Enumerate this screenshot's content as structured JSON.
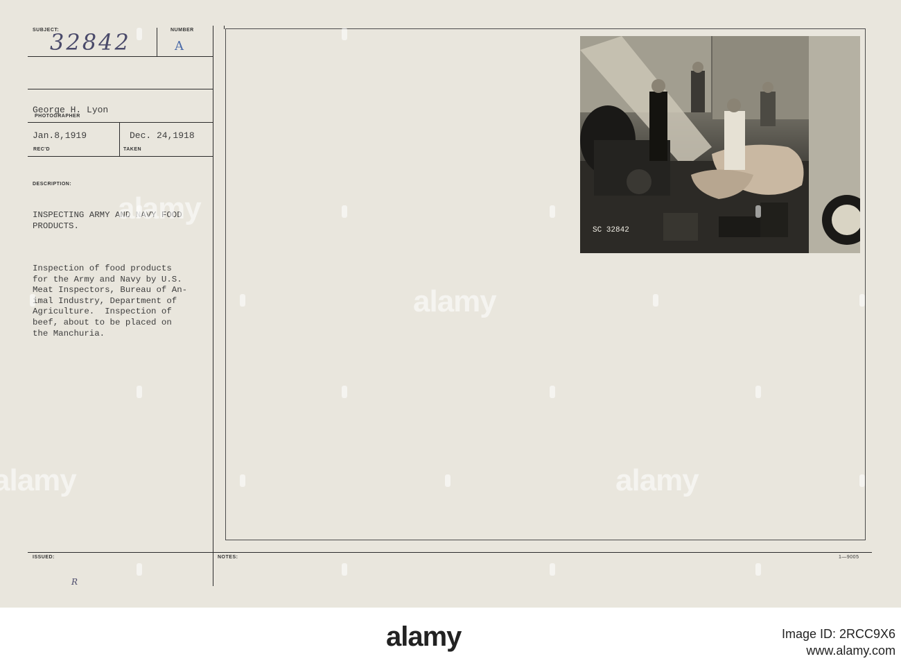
{
  "card": {
    "subject_label": "SUBJECT:",
    "subject_number": "32842",
    "number_label": "NUMBER",
    "number_value": "A",
    "photographer_name": "George H. Lyon",
    "photographer_label": "PHOTOGRAPHER",
    "received_date": "Jan.8,1919",
    "received_label": "REC'D",
    "taken_date": "Dec. 24,1918",
    "taken_label": "TAKEN",
    "description_label": "DESCRIPTION:",
    "title_lines": [
      "INSPECTING ARMY AND NAVY FOOD",
      "PRODUCTS."
    ],
    "description_lines": [
      "Inspection of food products",
      "for the Army and Navy by U.S.",
      "Meat Inspectors, Bureau of An-",
      "imal Industry, Department of",
      "Agriculture.  Inspection of",
      "beef, about to be placed on",
      "the Manchuria."
    ],
    "issued_label": "ISSUED:",
    "issued_mark": "R",
    "notes_label": "NOTES:",
    "form_number": "1—9005",
    "photo_caption": "SC 32842"
  },
  "watermark": {
    "text": "alamy"
  },
  "footer": {
    "logo": "alamy",
    "image_id": "Image ID: 2RCC9X6",
    "site": "www.alamy.com"
  }
}
